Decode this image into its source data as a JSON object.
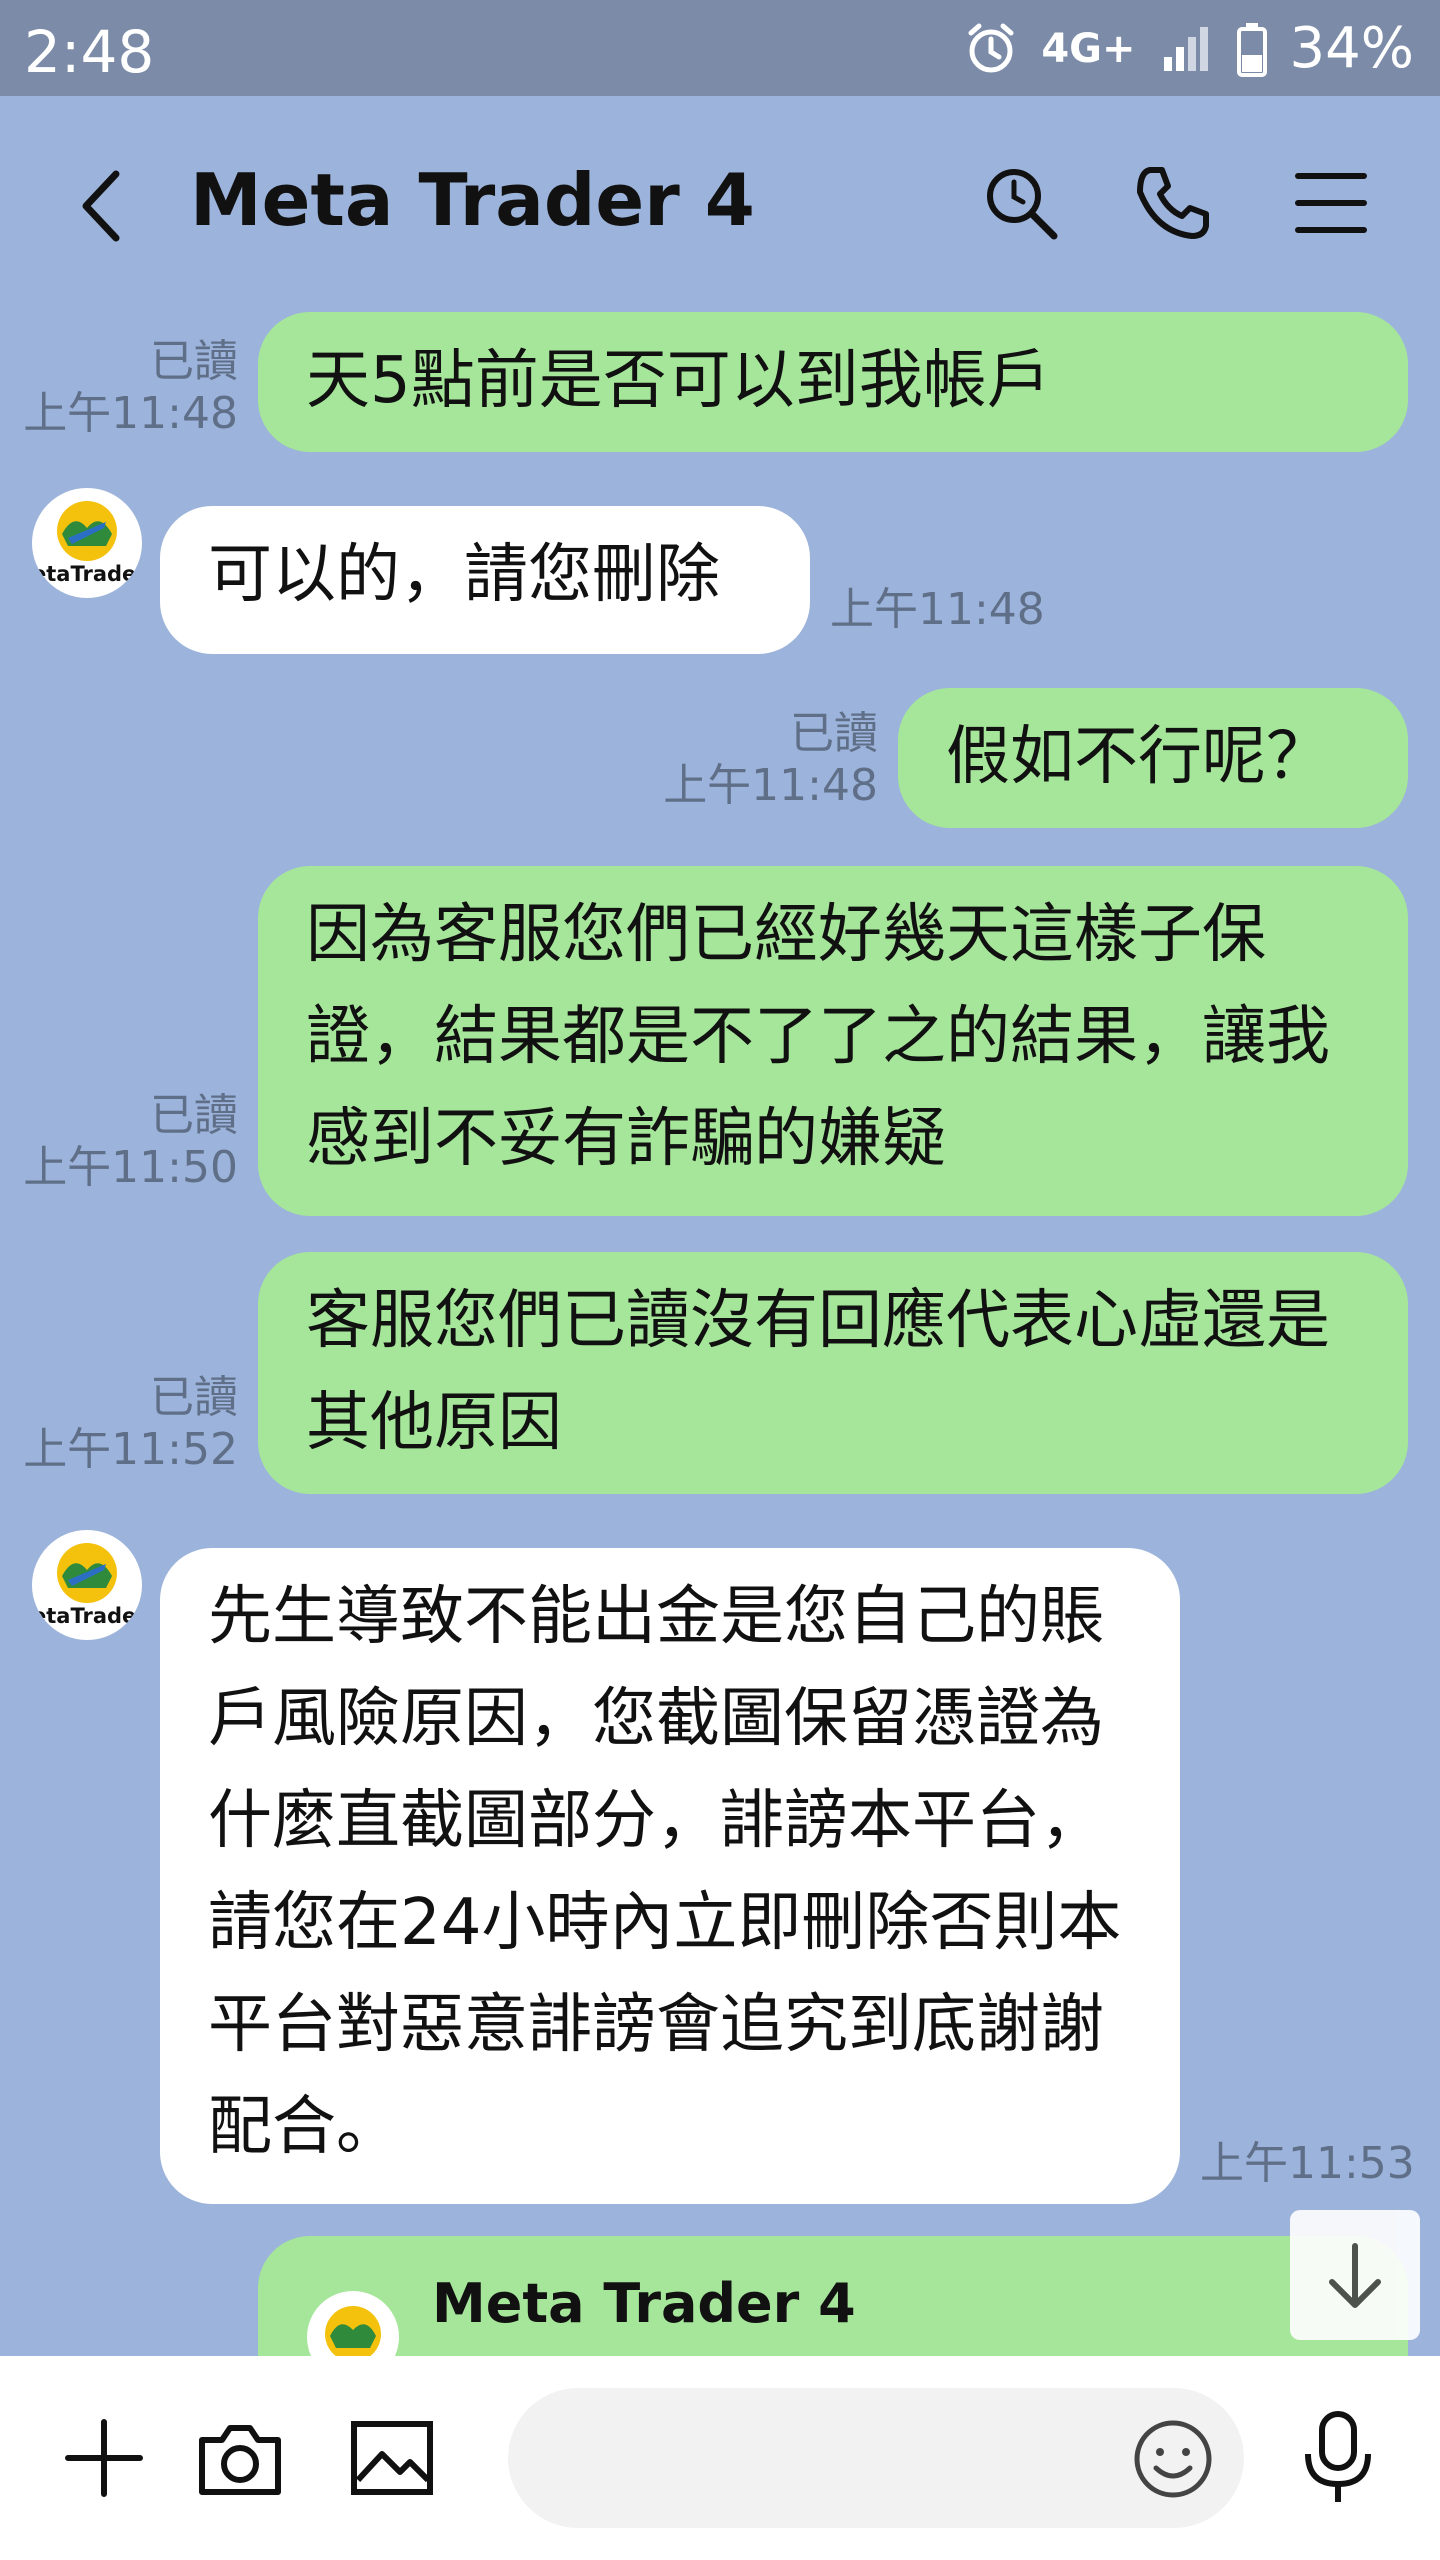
{
  "status": {
    "time": "2:48",
    "network": "4G+",
    "battery": "34%"
  },
  "header": {
    "title": "Meta Trader 4"
  },
  "messages": [
    {
      "side": "right",
      "text": "天5點前是否可以到我帳戶",
      "read": "已讀",
      "time": "上午11:48"
    },
    {
      "side": "left",
      "avatar_label": "etaTrader",
      "text": "可以的，請您刪除",
      "time": "上午11:48"
    },
    {
      "side": "right",
      "text": "假如不行呢？",
      "read": "已讀",
      "time": "上午11:48"
    },
    {
      "side": "right",
      "text": "因為客服您們已經好幾天這樣子保證，結果都是不了了之的結果，讓我感到不妥有詐騙的嫌疑",
      "read": "已讀",
      "time": "上午11:50"
    },
    {
      "side": "right",
      "text": "客服您們已讀沒有回應代表心虛還是其他原因",
      "read": "已讀",
      "time": "上午11:52"
    },
    {
      "side": "left",
      "avatar_label": "etaTrader",
      "text": "先生導致不能出金是您自己的賬戶風險原因，您截圖保留憑證為什麼直截圖部分，誹謗本平台，請您在24小時內立即刪除否則本平台對惡意誹謗會追究到底謝謝配合。",
      "time": "上午11:53"
    },
    {
      "side": "right",
      "shared_contact": "Meta Trader 4"
    }
  ],
  "icons": {
    "back": "chevron-left-icon",
    "search": "search-icon",
    "call": "phone-icon",
    "menu": "menu-icon",
    "add": "plus-icon",
    "camera": "camera-icon",
    "gallery": "image-icon",
    "emoji": "emoji-icon",
    "mic": "microphone-icon",
    "scroll": "arrow-down-icon"
  },
  "colors": {
    "background": "#9cb3db",
    "outgoing": "#a6e69a",
    "incoming": "#ffffff",
    "statusbar": "#7c8ca8"
  }
}
